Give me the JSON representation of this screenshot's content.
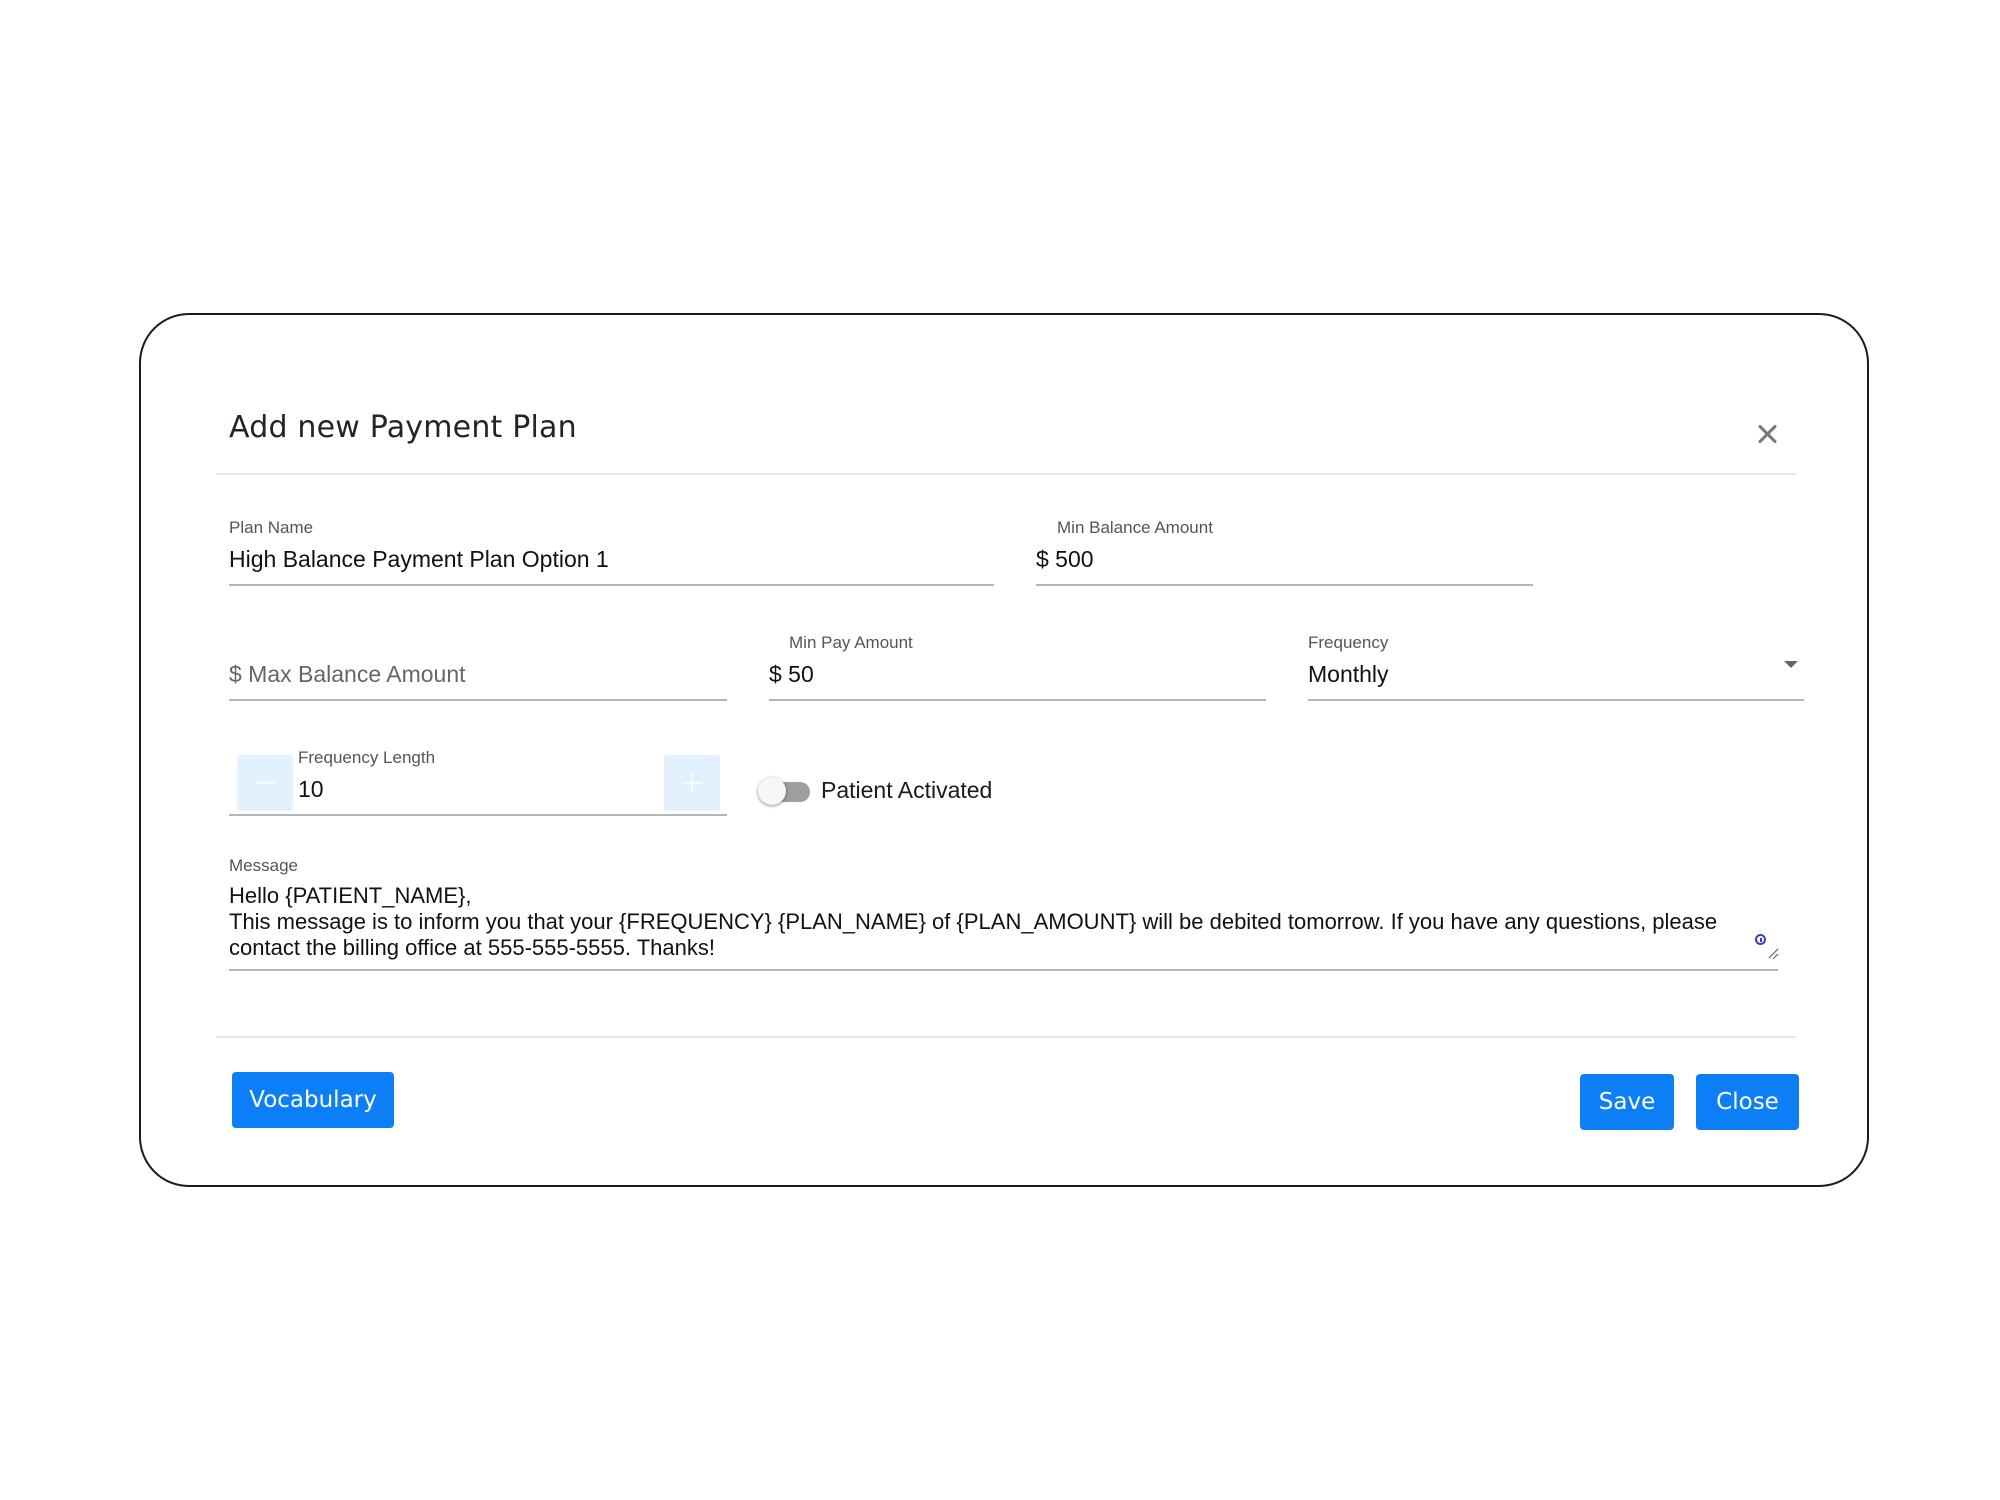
{
  "dialog": {
    "title": "Add new Payment Plan"
  },
  "form": {
    "plan_name": {
      "label": "Plan Name",
      "value": "High Balance Payment Plan Option 1"
    },
    "min_balance": {
      "label": "Min Balance Amount",
      "value": "$ 500"
    },
    "max_balance": {
      "placeholder": "$ Max Balance Amount"
    },
    "min_pay": {
      "label": "Min Pay Amount",
      "value": "$ 50"
    },
    "frequency": {
      "label": "Frequency",
      "value": "Monthly"
    },
    "frequency_length": {
      "label": "Frequency Length",
      "value": "10"
    },
    "patient_activated": {
      "label": "Patient Activated",
      "checked": false
    },
    "message": {
      "label": "Message",
      "lines": [
        "Hello  {PATIENT_NAME},",
        "This message is to inform you that your {FREQUENCY} {PLAN_NAME} of {PLAN_AMOUNT} will be debited tomorrow. If you have any questions, please",
        "contact the billing office at 555-555-5555. Thanks!"
      ]
    }
  },
  "footer": {
    "vocabulary_label": "Vocabulary",
    "save_label": "Save",
    "close_label": "Close"
  },
  "colors": {
    "primary": "#0d7ff6",
    "stepper_bg": "#e3f0fd",
    "toggle_off": "#9e9e9e"
  }
}
